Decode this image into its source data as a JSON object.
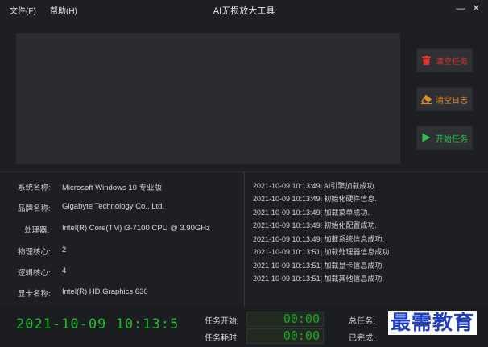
{
  "menu": {
    "file": "文件(F)",
    "help": "帮助(H)"
  },
  "window": {
    "title": "AI无损放大工具"
  },
  "buttons": {
    "clear_tasks": "清空任务",
    "clear_log": "清空日志",
    "start_task": "开始任务"
  },
  "system_info": [
    {
      "label": "系统名称:",
      "value": "Microsoft Windows 10 专业版"
    },
    {
      "label": "品牌名称:",
      "value": "Gigabyte Technology Co., Ltd."
    },
    {
      "label": "处理器:",
      "value": "Intel(R) Core(TM) i3-7100 CPU @ 3.90GHz"
    },
    {
      "label": "物理核心:",
      "value": "2"
    },
    {
      "label": "逻辑核心:",
      "value": "4"
    },
    {
      "label": "显卡名称:",
      "value": "Intel(R) HD Graphics 630"
    }
  ],
  "log": [
    "2021-10-09 10:13:49| AI引擎加载成功.",
    "2021-10-09 10:13:49| 初始化硬件信息.",
    "2021-10-09 10:13:49| 加载菜单成功.",
    "2021-10-09 10:13:49| 初始化配置成功.",
    "2021-10-09 10:13:49| 加载系统信息成功.",
    "2021-10-09 10:13:51| 加载处理器信息成功.",
    "2021-10-09 10:13:51| 加载显卡信息成功.",
    "2021-10-09 10:13:51| 加载其他信息成功."
  ],
  "status": {
    "clock": "2021-10-09 10:13:5",
    "task_start_label": "任务开始:",
    "task_start_value": "00:00",
    "task_elapsed_label": "任务耗时:",
    "task_elapsed_value": "00:00",
    "total_tasks_label": "总任务:",
    "completed_label": "已完成:"
  },
  "watermark": "最需教育",
  "colors": {
    "red": "#e0342f",
    "orange": "#e08a2a",
    "green": "#2ec24a",
    "lcd_green": "#1aa824"
  },
  "icons": {
    "clear_tasks": "trash-icon",
    "clear_log": "eraser-icon",
    "start_task": "play-icon"
  }
}
